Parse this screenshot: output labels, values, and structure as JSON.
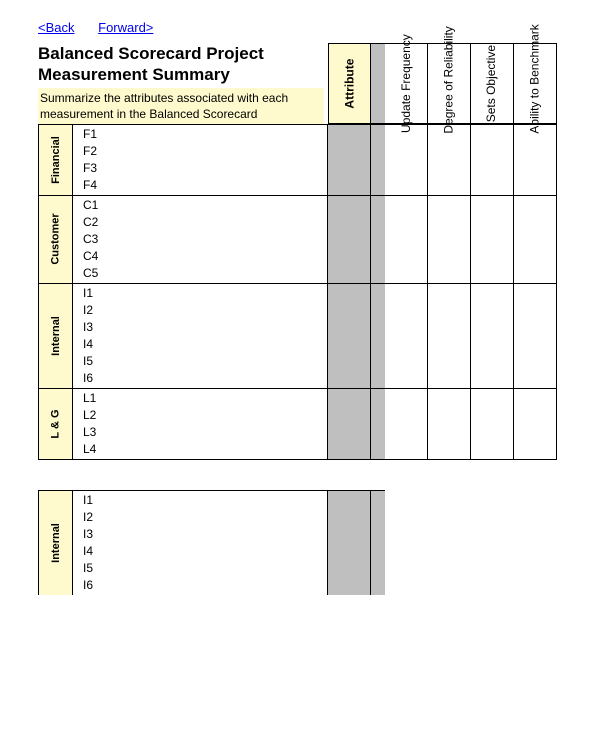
{
  "nav": {
    "back": "<Back",
    "forward": "Forward>"
  },
  "title": "Balanced Scorecard Project Measurement Summary",
  "subtitle": "Summarize the attributes associated with each measurement in the Balanced Scorecard",
  "columns": {
    "attribute": "Attribute",
    "update_frequency": "Update Frequency",
    "degree_reliability": "Degree of Reliability",
    "sets_objective": "Sets Objective",
    "ability_benchmark": "Ability to Benchmark"
  },
  "groups": [
    {
      "label": "Financial",
      "items": [
        "F1",
        "F2",
        "F3",
        "F4"
      ]
    },
    {
      "label": "Customer",
      "items": [
        "C1",
        "C2",
        "C3",
        "C4",
        "C5"
      ]
    },
    {
      "label": "Internal",
      "items": [
        "I1",
        "I2",
        "I3",
        "I4",
        "I5",
        "I6"
      ]
    },
    {
      "label": "L & G",
      "items": [
        "L1",
        "L2",
        "L3",
        "L4"
      ]
    }
  ],
  "second_block": {
    "label": "Internal",
    "items": [
      "I1",
      "I2",
      "I3",
      "I4",
      "I5",
      "I6"
    ]
  }
}
